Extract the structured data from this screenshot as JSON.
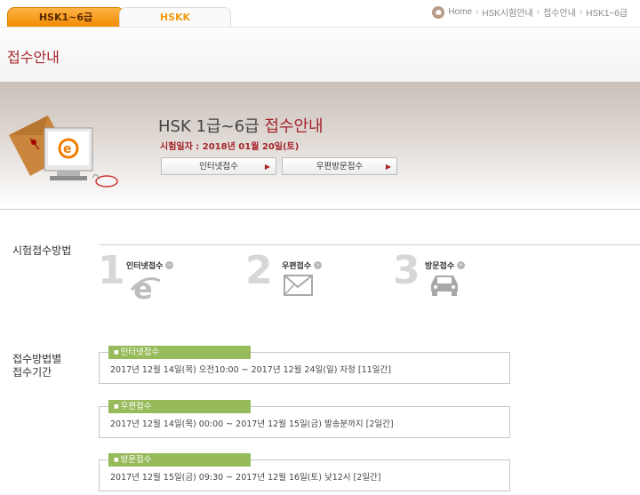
{
  "tabs": [
    {
      "label": "HSK1~6급",
      "active": true
    },
    {
      "label": "HSKK",
      "active": false
    }
  ],
  "breadcrumb": [
    "Home",
    "HSK시험안내",
    "접수안내",
    "HSK1~6급"
  ],
  "page_title": "접수안내",
  "hero": {
    "title_main": "HSK 1급~6급",
    "title_accent": "접수안내",
    "date_text": "시험일자 : 2018년 01월 20일(토)",
    "btn_online": "인터넷접수",
    "btn_post": "우편방문접수"
  },
  "method": {
    "label": "시험접수방법",
    "steps": [
      {
        "num": "1",
        "label": "인터넷접수",
        "icon": "internet-explorer-icon"
      },
      {
        "num": "2",
        "label": "우편접수",
        "icon": "envelope-icon"
      },
      {
        "num": "3",
        "label": "방문접수",
        "icon": "car-icon"
      }
    ]
  },
  "period": {
    "label_line1": "접수방법별",
    "label_line2": "접수기간",
    "items": [
      {
        "tag": "인터넷접수",
        "text": "2017년 12월 14일(목) 오전10:00 ~ 2017년 12월 24일(일) 자정 [11일간]"
      },
      {
        "tag": "우편접수",
        "text": "2017년 12월 14일(목) 00:00 ~ 2017년 12월 15일(금) 발송분까지 [2일간]"
      },
      {
        "tag": "방문접수",
        "text": "2017년 12월 15일(금) 09:30 ~ 2017년 12월 16일(토) 낮12시 [2일간]"
      }
    ]
  },
  "colors": {
    "accent": "#a5242a",
    "tab_orange": "#f28c00",
    "tag_green": "#97ba5b"
  }
}
